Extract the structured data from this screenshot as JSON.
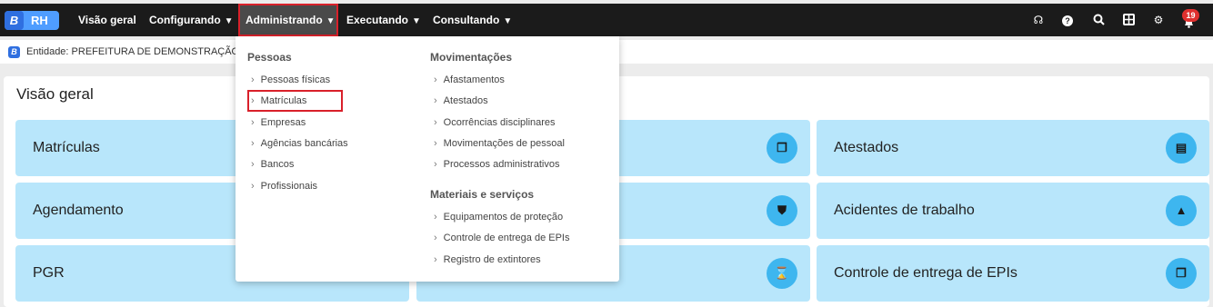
{
  "logo": {
    "letter": "B",
    "app": "RH"
  },
  "nav": {
    "items": [
      "Visão geral",
      "Configurando",
      "Administrando",
      "Executando",
      "Consultando"
    ],
    "chevron": "⌄",
    "active": "Administrando"
  },
  "topicons": {
    "notifications_count": "19",
    "icons": [
      "support-icon",
      "help-icon",
      "search-icon",
      "apps-icon",
      "settings-icon",
      "bell-icon"
    ]
  },
  "entity": {
    "badge": "B",
    "text": "Entidade: PREFEITURA DE DEMONSTRAÇÃO"
  },
  "page": {
    "title": "Visão geral"
  },
  "cards": {
    "c1": "Matrículas",
    "c2": "Agendamento",
    "c3": "PGR",
    "c4": "Atestados",
    "c5": "Acidentes de trabalho",
    "c6": "Controle de entrega de EPIs"
  },
  "menu": {
    "pessoas": {
      "heading": "Pessoas",
      "items": [
        "Pessoas físicas",
        "Matrículas",
        "Empresas",
        "Agências bancárias",
        "Bancos",
        "Profissionais"
      ]
    },
    "movimentacoes": {
      "heading": "Movimentações",
      "items": [
        "Afastamentos",
        "Atestados",
        "Ocorrências disciplinares",
        "Movimentações de pessoal",
        "Processos administrativos"
      ]
    },
    "materiais": {
      "heading": "Materiais e serviços",
      "items": [
        "Equipamentos de proteção",
        "Controle de entrega de EPIs",
        "Registro de extintores"
      ]
    },
    "arrow": "›"
  },
  "colors": {
    "topbar": "#1b1b1b",
    "card": "#b8e6fb",
    "card_icon": "#3eb6ef",
    "highlight": "#d9202a"
  }
}
